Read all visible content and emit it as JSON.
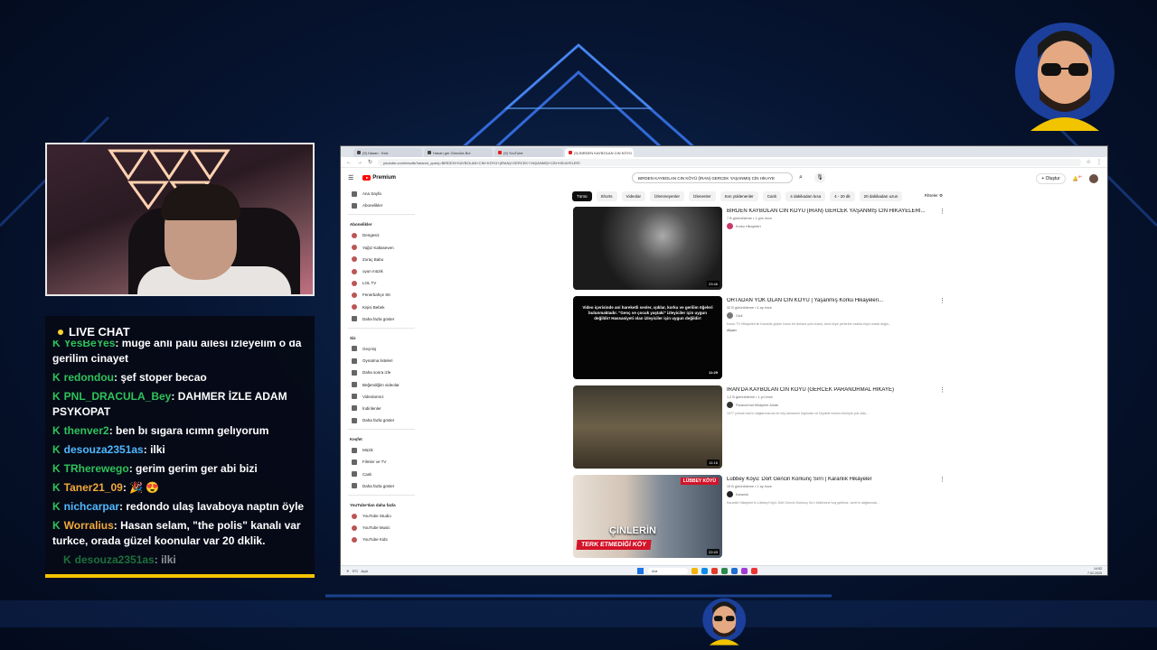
{
  "stream": {
    "chat_title": "LIVE CHAT",
    "messages": [
      {
        "user": "YesBeYes",
        "text": ": müge anlı palu ailesi izleyelim o da gerilim cinayet",
        "color": "green"
      },
      {
        "user": "redondou",
        "text": ": şef stoper becao",
        "color": "green"
      },
      {
        "user": "PNL_DRACULA_Bey",
        "text": ": DAHMER İZLE ADAM PSYKOPAT",
        "color": "green"
      },
      {
        "user": "thenver2",
        "text": ": ben bı sıgara ıcımn gelıyorum",
        "color": "green"
      },
      {
        "user": "desouza2351as",
        "text": ": ilki",
        "color": "cyan"
      },
      {
        "user": "TRherewego",
        "text": ": gerim gerim ger abi bizi",
        "color": "green"
      },
      {
        "user": "Taner21_09",
        "text": ": 🎉 😍",
        "color": "gold"
      },
      {
        "user": "nichcarpar",
        "text": ": redondo ulaş lavaboya naptın öyle",
        "color": "cyan"
      },
      {
        "user": "Worralius",
        "text": ": Hasan selam, \"the polis\" kanalı var turkce, orada güzel koonular var 20 dklik.",
        "color": "gold"
      }
    ],
    "pending_message": {
      "user": "desouza2351as",
      "text": ": ilki"
    }
  },
  "browser": {
    "tabs": [
      {
        "label": "(9) Hasan ∙ Kick",
        "active": false
      },
      {
        "label": "Hasan ger Güncüla Bul",
        "active": false
      },
      {
        "label": "(9) YouTube",
        "active": false
      },
      {
        "label": "(9) BIRDEN KAYBOLAN CIN KÖYÜ",
        "active": true
      }
    ],
    "url": "youtube.com/results?search_query=BIRDEN+KAYBOLAN+CIN+KÖYÜ+(IRAN)+GERCEK+YAŞANMIŞ+CİN+HİKAYELERİ",
    "logo_text": "Premium",
    "search_value": "BIRDEN KAYBOLAN CIN KÖYÜ (İRAN) GERCEK YAŞANMIŞ CİN HİKAYE",
    "create_label": "Oluştur",
    "notif_count": "9+"
  },
  "sidebar": {
    "top": [
      {
        "label": "Ana Sayfa",
        "icon": "home-icon"
      },
      {
        "label": "Abonelikler",
        "icon": "subscriptions-icon"
      }
    ],
    "subs_header": "Abonelikler",
    "subs": [
      {
        "label": "Dengesiz"
      },
      {
        "label": "Yağız Kaltaseven"
      },
      {
        "label": "Zoraç Babo"
      },
      {
        "label": "oyun müzik"
      },
      {
        "label": "LOL TV"
      },
      {
        "label": "Fenerbahçe SK"
      },
      {
        "label": "Kişisi Bebek"
      },
      {
        "label": "Daha fazla göster"
      }
    ],
    "you_header": "Siz",
    "you": [
      {
        "label": "Geçmiş"
      },
      {
        "label": "Oynatma listeleri"
      },
      {
        "label": "Daha sonra izle"
      },
      {
        "label": "Beğendiğim videolar"
      },
      {
        "label": "Videolarınız"
      },
      {
        "label": "İndirilenler"
      },
      {
        "label": "Daha fazla göster"
      }
    ],
    "explore_header": "Keşfet",
    "explore": [
      {
        "label": "Müzik"
      },
      {
        "label": "Filmler ve TV"
      },
      {
        "label": "Canlı"
      },
      {
        "label": "Daha fazla göster"
      }
    ],
    "more_header": "YouTube'dan daha fazla",
    "more": [
      {
        "label": "YouTube Studio"
      },
      {
        "label": "YouTube Music"
      },
      {
        "label": "YouTube Kids"
      }
    ]
  },
  "chips": [
    "Tümü",
    "Shorts",
    "Videolar",
    "İzlenmeyenler",
    "İzlenenler",
    "Son yüklenenler",
    "Canlı",
    "4 dakikadan kısa",
    "4 - 20 dk",
    "20 dakikadan uzun"
  ],
  "filters_label": "Filtreler",
  "results": [
    {
      "title": "BIRDEN KAYBOLAN CIN KÖYÜ (İRAN) GERCEK YAŞANMIŞ CİN HİKAYELERİ...",
      "meta": "7 B görüntüleme • 1 gün önce",
      "channel": "Korku Hikayeleri",
      "desc": "",
      "duration": "23:46",
      "thumb_text": ""
    },
    {
      "title": "ORTADAN YOK OLAN CIN KÖYÜ | Yaşanmış Korku Hikayeleri...",
      "meta": "32 B görüntüleme • 4 ay önce",
      "channel": "Gizli",
      "desc": "Korku TV Hikâyeleri ile Karanlık güçler korku bir Ankara yolu kuzey. Ama köye yerlerine uzakta köyü orada doğru...",
      "duration": "11:29",
      "thumb_text": "Video içerisinde ani hareketli sesler, ışıklar, korku ve gerilim öğeleri bulunmaktadır. \"Genç ve çocuk yaştaki\" izleyiciler için uygun değildir! Hassasiyeti olan izleyiciler için uygun değildir!",
      "badge": "Altyazı"
    },
    {
      "title": "İRAN'DA KAYBOLAN CIN KÖYÜ (GERCEK PARANORMAL HİKAYE)",
      "meta": "1,2 B görüntüleme • 1 yıl önce",
      "channel": "Paranormal Hikâyeler Anlatı",
      "desc": "1977 yılında İran'ın dağlarında da bir köy tamamen kayboldu ve köydeki herkes tümüyle yok oldu...",
      "duration": "11:16",
      "thumb_text": ""
    },
    {
      "title": "Lübbey Köyü: Dört Gencin Korkunç Sırrı | Karanlık Hikâyeler",
      "meta": "19 B görüntüleme • 1 ay önce",
      "channel": "Karanlık",
      "desc": "Karanlık Hikâyeler'in Lübbey Köyü: Dört Gencin Korkunç Sırrı bölümüne hoş geldiniz. İzmir'in dağlarında...",
      "duration": "22:43",
      "thumb_text": "ÇİNLERİN",
      "thumb_banner": "TERK ETMEDİĞİ KÖY",
      "thumb_badge": "LÜBBEY KÖYÜ"
    }
  ],
  "taskbar": {
    "weather": "9°C",
    "weather_sub": "Açık",
    "search_placeholder": "Ara",
    "time": "14:52",
    "date": "7.02.2025"
  }
}
